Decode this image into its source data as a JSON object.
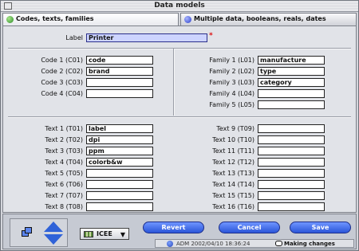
{
  "window": {
    "title": "Data models"
  },
  "tabs": [
    {
      "label": "Codes, texts, families"
    },
    {
      "label": "Multiple data, booleans, reals, dates"
    }
  ],
  "form": {
    "label_caption": "Label",
    "label_value": "Printer",
    "required_mark": "*",
    "codes": [
      {
        "caption": "Code 1 (C01)",
        "value": "code"
      },
      {
        "caption": "Code 2 (C02)",
        "value": "brand"
      },
      {
        "caption": "Code 3 (C03)",
        "value": ""
      },
      {
        "caption": "Code 4 (C04)",
        "value": ""
      }
    ],
    "families": [
      {
        "caption": "Family 1 (L01)",
        "value": "manufacture"
      },
      {
        "caption": "Family 2 (L02)",
        "value": "type"
      },
      {
        "caption": "Family 3 (L03)",
        "value": "category"
      },
      {
        "caption": "Family 4 (L04)",
        "value": ""
      },
      {
        "caption": "Family 5 (L05)",
        "value": ""
      }
    ],
    "texts_left": [
      {
        "caption": "Text 1 (T01)",
        "value": "label"
      },
      {
        "caption": "Text 2 (T02)",
        "value": "dpi"
      },
      {
        "caption": "Text 3 (T03)",
        "value": "ppm"
      },
      {
        "caption": "Text 4 (T04)",
        "value": "colorb&w"
      },
      {
        "caption": "Text 5 (T05)",
        "value": ""
      },
      {
        "caption": "Text 6 (T06)",
        "value": ""
      },
      {
        "caption": "Text 7 (T07)",
        "value": ""
      },
      {
        "caption": "Text 8 (T08)",
        "value": ""
      }
    ],
    "texts_right": [
      {
        "caption": "Text 9 (T09)",
        "value": ""
      },
      {
        "caption": "Text 10 (T10)",
        "value": ""
      },
      {
        "caption": "Text 11 (T11)",
        "value": ""
      },
      {
        "caption": "Text 12 (T12)",
        "value": ""
      },
      {
        "caption": "Text 13 (T13)",
        "value": ""
      },
      {
        "caption": "Text 14 (T14)",
        "value": ""
      },
      {
        "caption": "Text 15 (T15)",
        "value": ""
      },
      {
        "caption": "Text 16 (T16)",
        "value": ""
      }
    ]
  },
  "footer": {
    "language_popup": "ICEE",
    "buttons": {
      "revert": "Revert",
      "cancel": "Cancel",
      "save": "Save"
    },
    "status": {
      "info": "ADM 2002/04/10 18:36:24",
      "changes": "Making changes"
    }
  },
  "colors": {
    "accent": "#2f62d8",
    "button": "#3b63e6",
    "field_highlight": "#cdd4ff",
    "required": "#dd1111"
  },
  "icons": [
    "close-box-icon",
    "green-ball-icon",
    "blue-ball-icon",
    "up-arrow-icon",
    "down-arrow-icon",
    "windows-icon",
    "flag-icon",
    "dropdown-arrow-icon",
    "user-icon",
    "speech-bubble-icon"
  ]
}
